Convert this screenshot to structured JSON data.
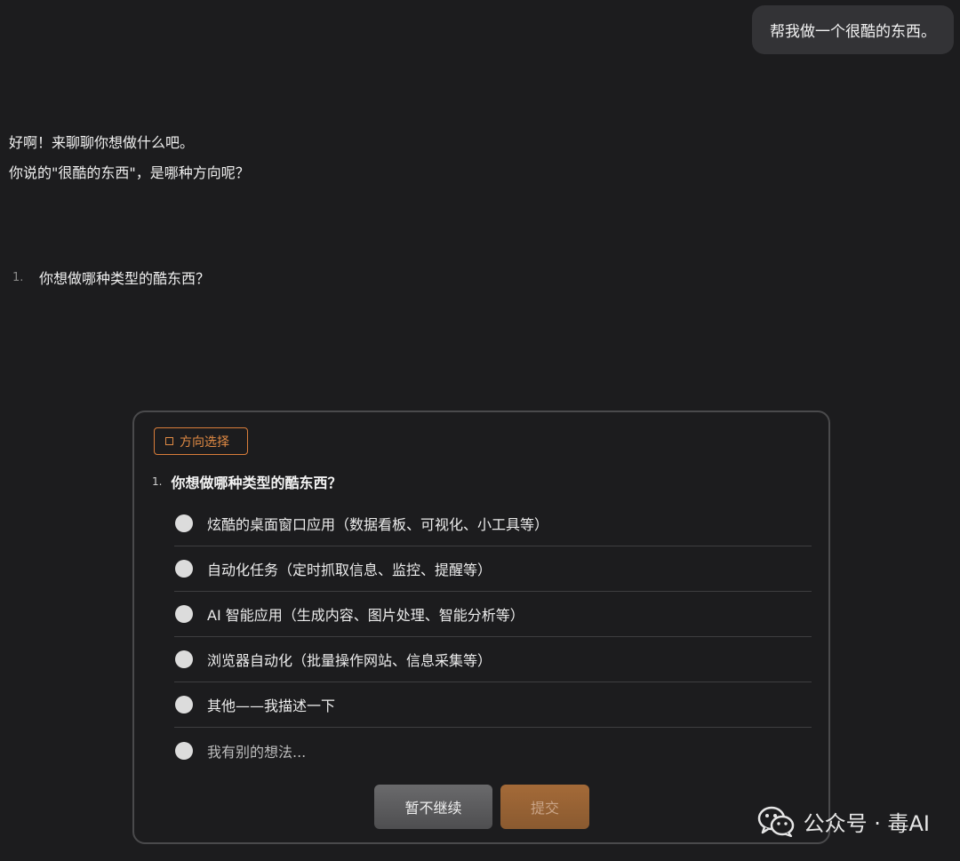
{
  "user_message": "帮我做一个很酷的东西。",
  "assistant": {
    "line1": "好啊！来聊聊你想做什么吧。",
    "line2": "你说的\"很酷的东西\"，是哪种方向呢？",
    "question_number": "1.",
    "question_text": "你想做哪种类型的酷东西？"
  },
  "panel": {
    "tag_label": "方向选择",
    "question_number": "1.",
    "question_text": "你想做哪种类型的酷东西？",
    "options": [
      "炫酷的桌面窗口应用（数据看板、可视化、小工具等）",
      "自动化任务（定时抓取信息、监控、提醒等）",
      "AI 智能应用（生成内容、图片处理、智能分析等）",
      "浏览器自动化（批量操作网站、信息采集等）",
      "其他——我描述一下",
      "我有别的想法..."
    ],
    "pause_button": "暂不继续",
    "submit_button": "提交"
  },
  "watermark": {
    "text": "公众号 · 毒AI",
    "icon": "wechat-icon"
  },
  "colors": {
    "background": "#1c1c1e",
    "accent": "#e08a44"
  }
}
